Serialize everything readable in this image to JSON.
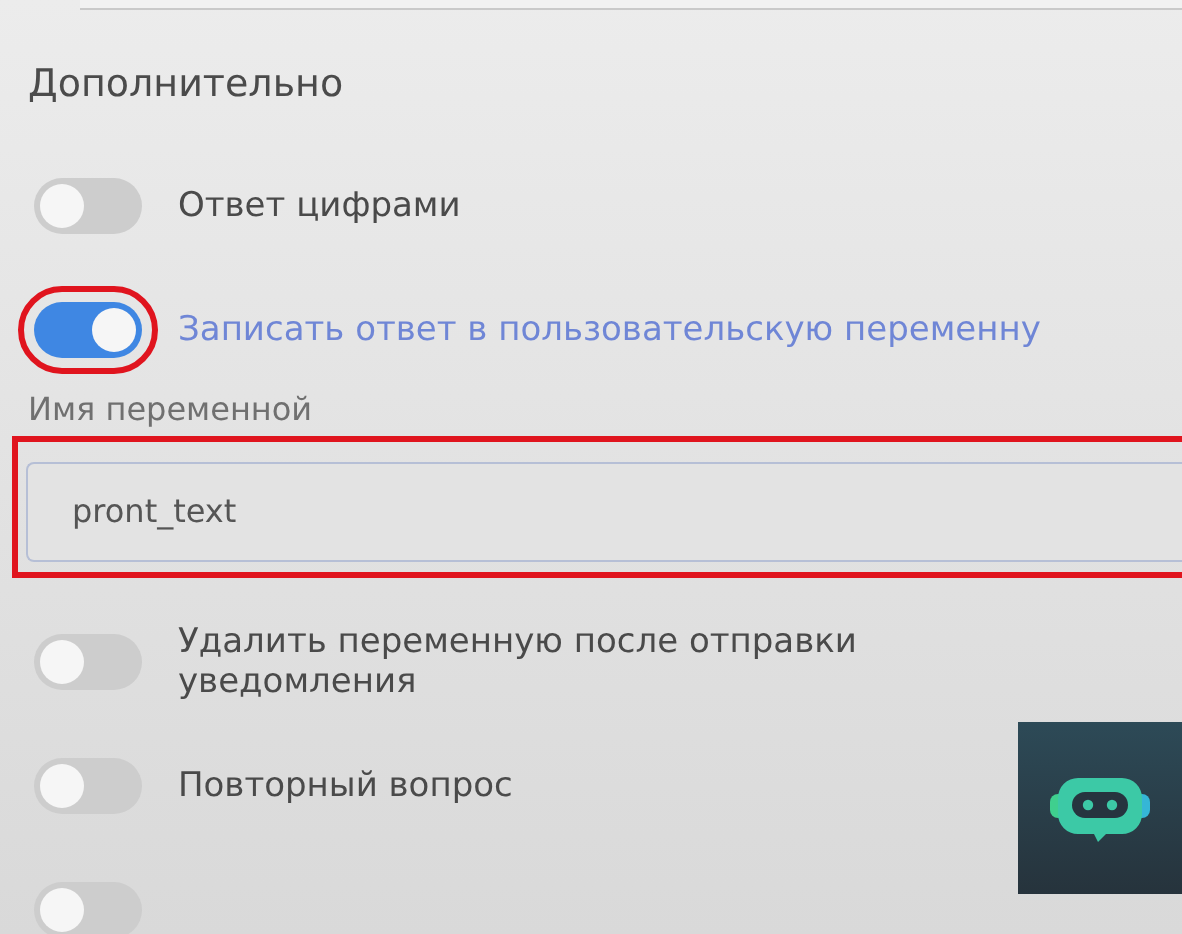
{
  "section": {
    "title": "Дополнительно"
  },
  "options": [
    {
      "kind": "toggle",
      "label": "Ответ цифрами",
      "on": false,
      "highlighted": false
    },
    {
      "kind": "toggle",
      "label": "Записать ответ в пользовательскую переменну",
      "on": true,
      "highlighted": true
    },
    {
      "kind": "field",
      "label": "Имя переменной",
      "value": "pront_text",
      "highlighted": true
    },
    {
      "kind": "toggle",
      "label": "Удалить переменную после отправки уведомления",
      "on": false,
      "highlighted": false
    },
    {
      "kind": "toggle",
      "label": "Повторный вопрос",
      "on": false,
      "highlighted": false
    },
    {
      "kind": "toggle",
      "on": false,
      "highlighted": false
    }
  ],
  "corner_badge": {
    "kind": "bot-logo"
  }
}
